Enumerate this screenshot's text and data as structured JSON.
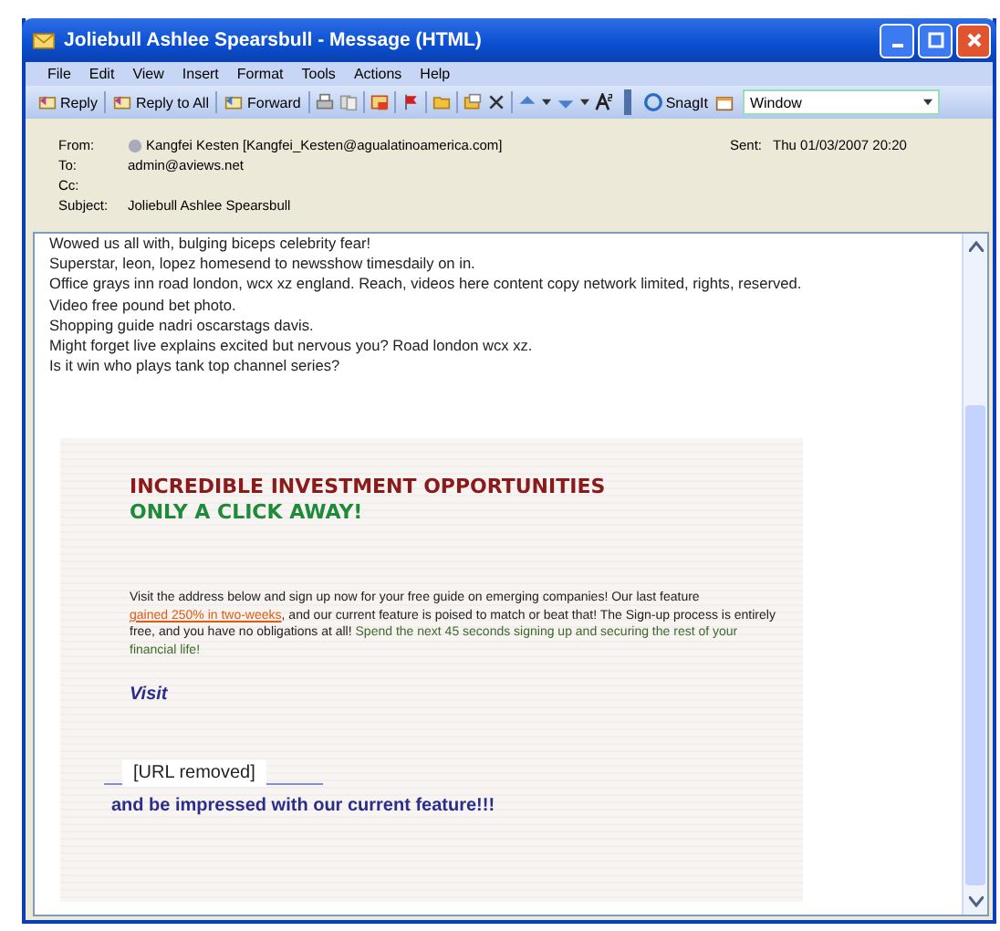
{
  "window": {
    "title": "Joliebull Ashlee Spearsbull - Message (HTML)"
  },
  "menu": [
    {
      "label": "File"
    },
    {
      "label": "Edit"
    },
    {
      "label": "View"
    },
    {
      "label": "Insert"
    },
    {
      "label": "Format"
    },
    {
      "label": "Tools"
    },
    {
      "label": "Actions"
    },
    {
      "label": "Help"
    }
  ],
  "toolbar": {
    "buttons": [
      {
        "label": "Reply"
      },
      {
        "label": "Reply to All"
      },
      {
        "label": "Forward"
      }
    ],
    "snagit": {
      "label": "SnagIt"
    },
    "window_select": {
      "value": "Window"
    }
  },
  "header": {
    "fields": [
      {
        "label": "From:",
        "value": "Kangfei Kesten [Kangfei_Kesten@agualatinoamerica.com]"
      },
      {
        "label": "To:",
        "value": "admin@aviews.net"
      },
      {
        "label": "Cc:"
      },
      {
        "label": "Subject:",
        "value": "Joliebull Ashlee Spearsbull"
      }
    ],
    "sent": {
      "label": "Sent:",
      "value": "Thu 01/03/2007 20:20"
    }
  },
  "body": {
    "lines": [
      "Wowed us all with, bulging biceps celebrity fear!",
      "Superstar, leon, lopez homesend to newsshow timesdaily on in.",
      "Office grays inn road london, wcx xz england. Reach, videos here content copy network limited, rights, reserved.",
      "Video free pound bet photo.",
      "Shopping guide nadri oscarstags davis.",
      "Might forget live explains excited but nervous you? Road london wcx xz.",
      "Is it win who plays tank top channel series?"
    ],
    "ad": {
      "headline": "INCREDIBLE INVESTMENT OPPORTUNITIES",
      "subheadline": "ONLY A CLICK AWAY!",
      "paragraph": [
        {
          "kind": "plain",
          "text": "Visit the address below and sign up now for your free guide on emerging companies! Our last feature "
        },
        {
          "kind": "link",
          "text": "gained 250% in two-weeks"
        },
        {
          "kind": "plain",
          "text": ", and our current feature is poised to match or beat that! The Sign-up process is entirely free, and you have no obligations at all! "
        },
        {
          "kind": "green",
          "text": "Spend the next 45 seconds signing up and securing the rest of your financial life!"
        }
      ],
      "visit": "Visit",
      "url_label": "[URL removed]",
      "closing": "and be impressed with our current feature!!!"
    }
  }
}
